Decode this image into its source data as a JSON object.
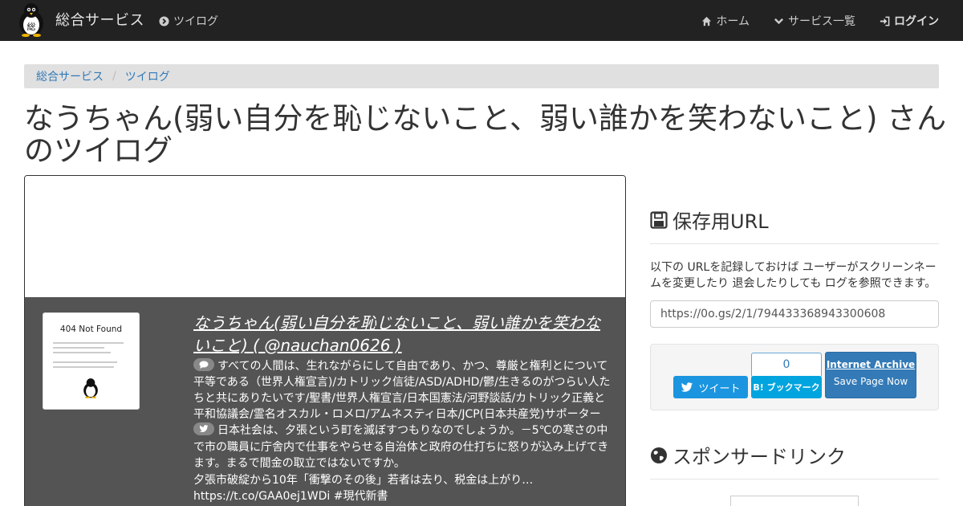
{
  "navbar": {
    "brand_label": "総合サービス",
    "service_label": "ツイログ",
    "home_label": "ホーム",
    "services_label": "サービス一覧",
    "login_label": "ログイン",
    "logo_icon": "penguin-logo-icon"
  },
  "breadcrumb": {
    "items": [
      "総合サービス",
      "ツイログ"
    ],
    "separator": "/"
  },
  "page": {
    "title": "なうちゃん(弱い自分を恥じないこと、弱い誰かを笑わないこと) さんのツイログ"
  },
  "profile": {
    "thumb_title": "404 Not Found",
    "link_text": "なうちゃん(弱い自分を恥じないこと、弱い誰かを笑わないこと) ( @nauchan0626 )",
    "bio": "すべての人間は、生れながらにして自由であり、かつ、尊厳と権利とについて平等である（世界人権宣言)/カトリック信徒/ASD/ADHD/鬱/生きるのがつらい人たちと共にありたいです/聖書/世界人権宣言/日本国憲法/河野談話/カトリック正義と平和協議会/霊名オスカル・ロメロ/アムネスティ日本/JCP(日本共産党)サポーター",
    "tweet": "日本社会は、夕張という町を滅ぼすつもりなのでしょうか。－5℃の寒さの中で市の職員に庁舎内で仕事をやらせる自治体と政府の仕打ちに怒りが込み上げてきます。まるで間金の取立ではないですか。",
    "tweet_extra_1": "夕張市破綻から10年「衝撃のその後」若者は去り、税金は上がり…",
    "tweet_extra_2": "https://t.co/GAA0ej1WDi #現代新書"
  },
  "sidebar": {
    "save_heading": "保存用URL",
    "save_description": "以下の URLを記録しておけば ユーザーがスクリーンネームを変更したり 退会したりしても ログを参照できます。",
    "save_url": "https://0o.gs/2/1/794433368943300608",
    "tweet_button": "ツイート",
    "hatena_count": "0",
    "hatena_button": "B! ブックマーク",
    "archive_title": "Internet Archive",
    "archive_subtitle": "Save Page Now",
    "sponsor_heading": "スポンサードリンク"
  },
  "colors": {
    "navbar_bg": "#222222",
    "link": "#337ab7",
    "tweet_panel_bg": "#545454",
    "twitter_blue": "#1b95e0",
    "hatena_blue": "#00a4de"
  }
}
